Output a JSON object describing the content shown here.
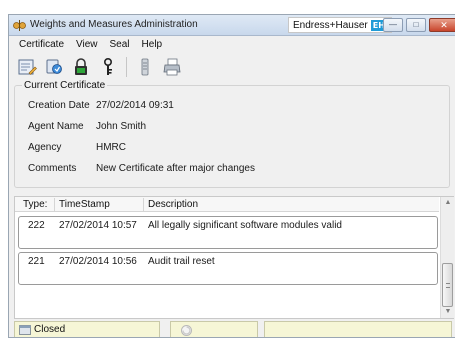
{
  "window": {
    "title": "Weights and Measures Administration",
    "brand_text": "Endress+Hauser",
    "brand_logo": "EH",
    "buttons": {
      "minimize": "minimize-icon",
      "maximize": "maximize-icon",
      "close": "close-icon"
    }
  },
  "menu": {
    "items": [
      {
        "label": "Certificate",
        "name": "menu-certificate"
      },
      {
        "label": "View",
        "name": "menu-view"
      },
      {
        "label": "Seal",
        "name": "menu-seal"
      },
      {
        "label": "Help",
        "name": "menu-help"
      }
    ]
  },
  "toolbar": {
    "icons": [
      "edit-certificate-icon",
      "connect-icon",
      "lock-icon",
      "seal-icon",
      "printer-settings-icon",
      "print-icon"
    ]
  },
  "certificate": {
    "legend": "Current Certificate",
    "fields": [
      {
        "label": "Creation Date",
        "value": "27/02/2014 09:31"
      },
      {
        "label": "Agent Name",
        "value": "John Smith"
      },
      {
        "label": "Agency",
        "value": "HMRC"
      },
      {
        "label": "Comments",
        "value": "New Certificate after major changes"
      }
    ]
  },
  "audit": {
    "columns": {
      "type": "Type:",
      "timestamp": "TimeStamp",
      "description": "Description"
    },
    "rows": [
      {
        "type": "222",
        "timestamp": "27/02/2014 10:57",
        "description": "All legally significant software modules valid"
      },
      {
        "type": "221",
        "timestamp": "27/02/2014 10:56",
        "description": "Audit trail reset"
      }
    ]
  },
  "status": {
    "state": "Closed",
    "state_icon": "closed-status-icon",
    "busy_icon": "busy-indicator-icon"
  },
  "colors": {
    "status_background": "#f6f6d6",
    "close_button": "#c8452c",
    "brand_logo": "#1f9bd7"
  }
}
